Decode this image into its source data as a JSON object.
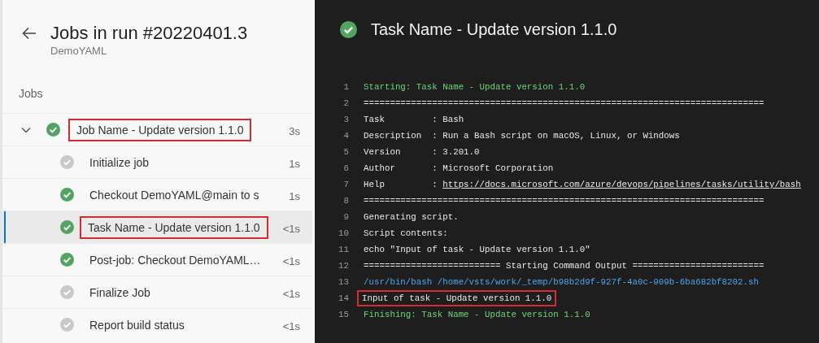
{
  "sidebar": {
    "title": "Jobs in run #20220401.3",
    "subtitle": "DemoYAML",
    "section_label": "Jobs",
    "jobs": [
      {
        "name": "Job Name - Update version 1.1.0",
        "duration": "3s",
        "kind": "succeeded",
        "expanded": true,
        "highlighted": true,
        "children": [
          {
            "name": "Initialize job",
            "duration": "1s",
            "kind": "skipped",
            "selected": false,
            "highlighted": false
          },
          {
            "name": "Checkout DemoYAML@main to s",
            "duration": "1s",
            "kind": "succeeded",
            "selected": false,
            "highlighted": false
          },
          {
            "name": "Task Name - Update version 1.1.0",
            "duration": "<1s",
            "kind": "succeeded",
            "selected": true,
            "highlighted": true
          },
          {
            "name": "Post-job: Checkout DemoYAML…",
            "duration": "<1s",
            "kind": "succeeded",
            "selected": false,
            "highlighted": false
          },
          {
            "name": "Finalize Job",
            "duration": "<1s",
            "kind": "skipped",
            "selected": false,
            "highlighted": false
          },
          {
            "name": "Report build status",
            "duration": "<1s",
            "kind": "skipped",
            "selected": false,
            "highlighted": false
          }
        ]
      }
    ]
  },
  "log": {
    "title": "Task Name - Update version 1.1.0",
    "kind": "succeeded",
    "lines": [
      {
        "number": "1",
        "kind": "section",
        "text": "Starting: Task Name - Update version 1.1.0",
        "highlighted": false
      },
      {
        "number": "2",
        "kind": "plain",
        "text": "============================================================================",
        "highlighted": false
      },
      {
        "number": "3",
        "kind": "plain",
        "text": "Task         : Bash",
        "highlighted": false
      },
      {
        "number": "4",
        "kind": "plain",
        "text": "Description  : Run a Bash script on macOS, Linux, or Windows",
        "highlighted": false
      },
      {
        "number": "5",
        "kind": "plain",
        "text": "Version      : 3.201.0",
        "highlighted": false
      },
      {
        "number": "6",
        "kind": "plain",
        "text": "Author       : Microsoft Corporation",
        "highlighted": false
      },
      {
        "number": "7",
        "kind": "plain",
        "text": "Help         : ",
        "link": "https://docs.microsoft.com/azure/devops/pipelines/tasks/utility/bash",
        "highlighted": false
      },
      {
        "number": "8",
        "kind": "plain",
        "text": "============================================================================",
        "highlighted": false
      },
      {
        "number": "9",
        "kind": "plain",
        "text": "Generating script.",
        "highlighted": false
      },
      {
        "number": "10",
        "kind": "plain",
        "text": "Script contents:",
        "highlighted": false
      },
      {
        "number": "11",
        "kind": "plain",
        "text": "echo \"Input of task - Update version 1.1.0\"",
        "highlighted": false
      },
      {
        "number": "12",
        "kind": "plain",
        "text": "========================== Starting Command Output =========================",
        "highlighted": false
      },
      {
        "number": "13",
        "kind": "command",
        "text": "/usr/bin/bash /home/vsts/work/_temp/b98b2d9f-927f-4a0c-909b-6ba682bf8202.sh",
        "highlighted": false
      },
      {
        "number": "14",
        "kind": "plain",
        "text": "Input of task - Update version 1.1.0",
        "highlighted": true
      },
      {
        "number": "15",
        "kind": "section",
        "text": "Finishing: Task Name - Update version 1.1.0",
        "highlighted": false
      }
    ]
  }
}
